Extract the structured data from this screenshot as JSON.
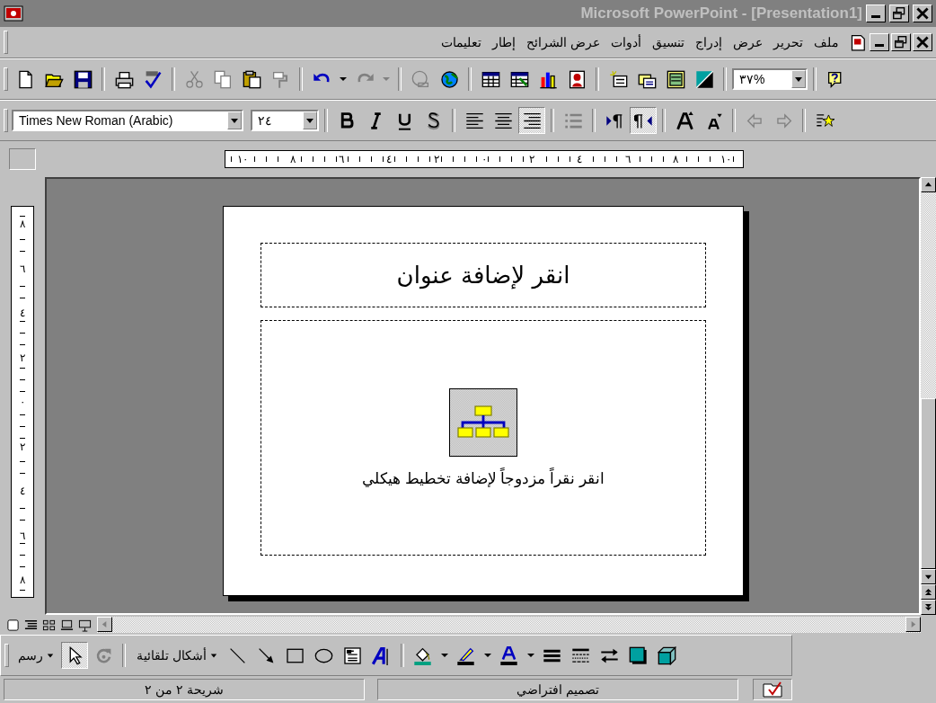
{
  "window": {
    "title": "Microsoft PowerPoint - [Presentation1]"
  },
  "menu": {
    "items": [
      "ملف",
      "تحرير",
      "عرض",
      "إدراج",
      "تنسيق",
      "أدوات",
      "عرض الشرائح",
      "إطار",
      "تعليمات"
    ]
  },
  "standard_toolbar": {
    "groups": [
      [
        {
          "kind": "new",
          "disabled": false
        },
        {
          "kind": "open",
          "disabled": false
        },
        {
          "kind": "save",
          "disabled": false
        }
      ],
      [
        {
          "kind": "print",
          "disabled": false
        },
        {
          "kind": "spelling",
          "disabled": false
        }
      ],
      [
        {
          "kind": "cut",
          "disabled": true
        },
        {
          "kind": "copy",
          "disabled": true
        },
        {
          "kind": "paste",
          "disabled": false
        },
        {
          "kind": "format-painter",
          "disabled": true
        }
      ],
      [
        {
          "kind": "undo",
          "disabled": false
        },
        {
          "kind": "dropdown",
          "disabled": false
        },
        {
          "kind": "redo",
          "disabled": true
        },
        {
          "kind": "dropdown",
          "disabled": true
        }
      ],
      [
        {
          "kind": "hyperlink",
          "disabled": true
        },
        {
          "kind": "web",
          "disabled": false
        }
      ],
      [
        {
          "kind": "table",
          "disabled": false
        },
        {
          "kind": "worksheet",
          "disabled": false
        },
        {
          "kind": "chart",
          "disabled": false
        },
        {
          "kind": "clipart",
          "disabled": false
        }
      ],
      [
        {
          "kind": "new-slide",
          "disabled": false
        },
        {
          "kind": "layout",
          "disabled": false
        },
        {
          "kind": "design",
          "disabled": false
        },
        {
          "kind": "grayscale",
          "disabled": false
        }
      ]
    ],
    "zoom": "٣٧%"
  },
  "formatting_toolbar": {
    "font": "Times New Roman (Arabic)",
    "size": "٢٤",
    "groups": [
      [
        {
          "kind": "bold",
          "selected": false,
          "disabled": false
        },
        {
          "kind": "italic",
          "selected": false,
          "disabled": false
        },
        {
          "kind": "underline",
          "selected": false,
          "disabled": false
        },
        {
          "kind": "shadow",
          "selected": false,
          "disabled": false
        }
      ],
      [
        {
          "kind": "align-left",
          "selected": false,
          "disabled": false
        },
        {
          "kind": "align-center",
          "selected": false,
          "disabled": false
        },
        {
          "kind": "align-right",
          "selected": true,
          "disabled": false
        }
      ],
      [
        {
          "kind": "bullets",
          "selected": false,
          "disabled": true
        }
      ],
      [
        {
          "kind": "ltr",
          "selected": false,
          "disabled": false
        },
        {
          "kind": "rtl",
          "selected": true,
          "disabled": false
        }
      ],
      [
        {
          "kind": "grow",
          "selected": false,
          "disabled": false
        },
        {
          "kind": "shrink",
          "selected": false,
          "disabled": false
        }
      ],
      [
        {
          "kind": "promote",
          "selected": false,
          "disabled": true
        },
        {
          "kind": "demote",
          "selected": false,
          "disabled": true
        }
      ],
      [
        {
          "kind": "animation",
          "selected": false,
          "disabled": false
        }
      ]
    ]
  },
  "horizontal_ruler": [
    "١٠",
    "٨",
    "٦",
    "٤",
    "٢",
    "٠",
    "٢",
    "٤",
    "٦",
    "٨",
    "١٠"
  ],
  "vertical_ruler": [
    "٨",
    "٦",
    "٤",
    "٢",
    "٠",
    "٢",
    "٤",
    "٦",
    "٨"
  ],
  "slide": {
    "title_placeholder": "انقر لإضافة عنوان",
    "body_placeholder": "انقر نقراً مزدوجاً لإضافة تخطيط هيكلي"
  },
  "view_buttons": [
    {
      "kind": "normal",
      "selected": false
    },
    {
      "kind": "outline",
      "selected": false
    },
    {
      "kind": "sorter",
      "selected": false
    },
    {
      "kind": "slide",
      "selected": false
    },
    {
      "kind": "show",
      "selected": false
    }
  ],
  "drawing_toolbar": {
    "draw_menu": "رسم",
    "autoshapes_menu": "أشكال تلقائية",
    "tools": [
      {
        "kind": "pointer",
        "selected": true,
        "disabled": false
      },
      {
        "kind": "rotate",
        "selected": false,
        "disabled": true
      },
      {
        "kind": "autoshapes",
        "selected": false,
        "disabled": false
      },
      {
        "kind": "line",
        "selected": false,
        "disabled": false
      },
      {
        "kind": "arrow",
        "selected": false,
        "disabled": false
      },
      {
        "kind": "rectangle",
        "selected": false,
        "disabled": false
      },
      {
        "kind": "oval",
        "selected": false,
        "disabled": false
      },
      {
        "kind": "textbox",
        "selected": false,
        "disabled": false
      },
      {
        "kind": "wordart",
        "selected": false,
        "disabled": false
      },
      {
        "kind": "fill-color",
        "selected": false,
        "disabled": false
      },
      {
        "kind": "line-color",
        "selected": false,
        "disabled": false
      },
      {
        "kind": "font-color",
        "selected": false,
        "disabled": false
      },
      {
        "kind": "line-style",
        "selected": false,
        "disabled": false
      },
      {
        "kind": "dash-style",
        "selected": false,
        "disabled": false
      },
      {
        "kind": "arrow-style",
        "selected": false,
        "disabled": false
      },
      {
        "kind": "shadow",
        "selected": false,
        "disabled": false
      },
      {
        "kind": "cube",
        "selected": false,
        "disabled": false
      }
    ]
  },
  "status_bar": {
    "slide_position": "شريحة ٢ من ٢",
    "design": "تصميم افتراضي"
  }
}
